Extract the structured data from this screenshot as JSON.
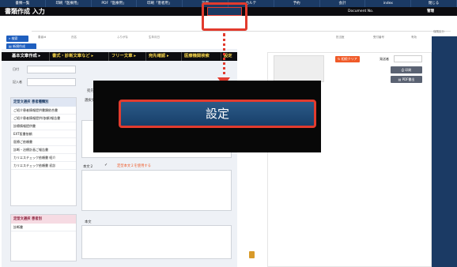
{
  "topnav": {
    "items": [
      "書類一覧",
      "印刷「医療用」",
      "PDF「医療用」",
      "印刷「患者用」",
      "設定",
      "カルテ",
      "予約",
      "会計",
      "index",
      "閉じる"
    ]
  },
  "header": {
    "title": "書類作成 入力",
    "doc_no_label": "Document No.",
    "admin_label": "管理"
  },
  "actions": {
    "search_label": "検索",
    "new_label": "新規作成"
  },
  "meta": {
    "labels": [
      "患者id",
      "氏名",
      "ふりがな",
      "生年月日",
      "担当医",
      "受付番号",
      "有効"
    ],
    "admin_sub": [
      "保険区分",
      "印刷日"
    ]
  },
  "tabs": {
    "items": [
      "基本文章作成 ▸",
      "書式・診断文章など ▸",
      "フリー文章 ▸",
      "宛先確認 ▸",
      "医療機関検索",
      "設定"
    ]
  },
  "form": {
    "date_label": "日付",
    "author_label": "記入者"
  },
  "fixed_text_list": {
    "header": "定型文選択 患者種類別",
    "items": [
      "ご紹介患者情報提供書類依合書",
      "ご紹介患者情報提供(依頼)報告書",
      "診療情報提供書",
      "EXT医書依頼",
      "医療ご依頼書",
      "診断・治療計画ご報告書",
      "カリエスチェック依頼書 紹介",
      "カリエスチェック依頼書 初診"
    ]
  },
  "fixed_text_list2": {
    "header": "定型文選択 患者別",
    "items": [
      "診断書"
    ]
  },
  "content": {
    "dest_label": "宛先",
    "select_label": "選択文",
    "ref_label": "参考",
    "honbun1_label": "本文１",
    "honbun2_label": "本文２",
    "honbun2_check": "✓",
    "honbun2_note": "定型本文２を使用する",
    "honbun_label": "本文"
  },
  "right": {
    "clear_label": "相続クリア",
    "recipient_label": "発送者",
    "print_label": "印刷",
    "pdf_label": "PDF書出"
  },
  "overlay": {
    "button_label": "設定"
  },
  "colors": {
    "nav": "#1b3a64",
    "header": "#0c0c10",
    "highlight": "#e23b2e",
    "accent_orange": "#f05a28"
  }
}
